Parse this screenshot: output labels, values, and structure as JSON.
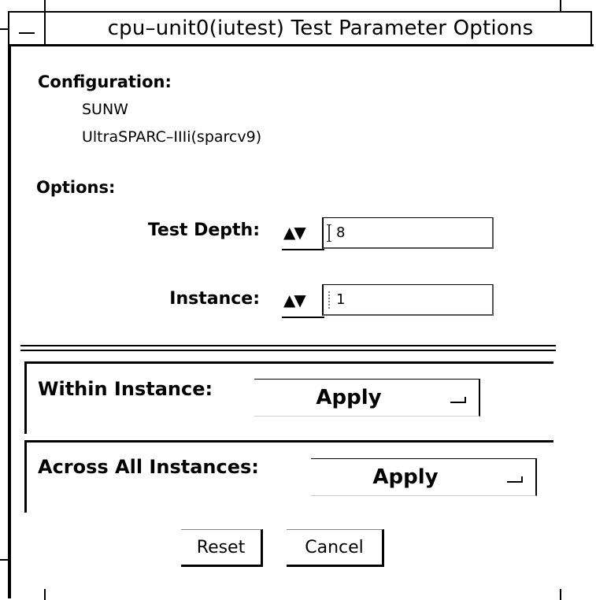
{
  "window": {
    "title": "cpu–unit0(iutest) Test Parameter Options"
  },
  "configuration": {
    "heading": "Configuration:",
    "lines": [
      "SUNW",
      "UltraSPARC–IIIi(sparcv9)"
    ]
  },
  "options": {
    "heading": "Options:",
    "fields": [
      {
        "label": "Test Depth:",
        "spinner": "▲▼",
        "value": "8"
      },
      {
        "label": "Instance:",
        "spinner": "▲▼",
        "value": "1"
      }
    ]
  },
  "scope": {
    "within": {
      "label": "Within Instance:",
      "button": "Apply"
    },
    "across": {
      "label": "Across All Instances:",
      "button": "Apply"
    }
  },
  "buttons": {
    "reset": "Reset",
    "cancel": "Cancel"
  },
  "icons": {
    "window_menu": "window-menu-icon",
    "spinner": "up-down-spinner-icon",
    "text_caret": "text-cursor-icon",
    "menu_indicator": "menu-indicator-icon"
  }
}
